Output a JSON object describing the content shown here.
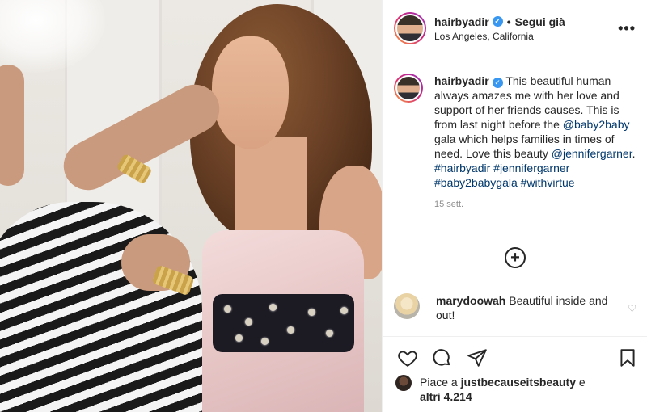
{
  "header": {
    "username": "hairbyadir",
    "separator": "•",
    "follow_label": "Segui già",
    "location": "Los Angeles, California",
    "more_label": "•••"
  },
  "caption": {
    "username": "hairbyadir",
    "text1": " This beautiful human always amazes me with her love and support of her friends causes. This is from last night before the ",
    "mention1": "@baby2baby",
    "text2": " gala which helps families in times of need. Love this beauty ",
    "mention2": "@jennifergarner",
    "text3": ".",
    "tags": [
      "#hairbyadir",
      "#jennifergarner",
      "#baby2babygala",
      "#withvirtue"
    ],
    "time": "15 sett."
  },
  "load_more_label": "+",
  "comment": {
    "username": "marydoowah",
    "text": " Beautiful inside and out!"
  },
  "likes": {
    "prefix": "Piace a ",
    "user": "justbecauseitsbeauty",
    "mid": " e",
    "others": "altri 4.214"
  },
  "icons": {
    "verified": "verified-badge-icon",
    "more": "more-options-icon",
    "like": "heart-icon",
    "comment": "comment-bubble-icon",
    "share": "paper-plane-icon",
    "save": "bookmark-icon",
    "load_more": "plus-circle-icon"
  },
  "colors": {
    "link": "#00376b",
    "verified": "#3897f0",
    "muted": "#8e8e8e"
  }
}
